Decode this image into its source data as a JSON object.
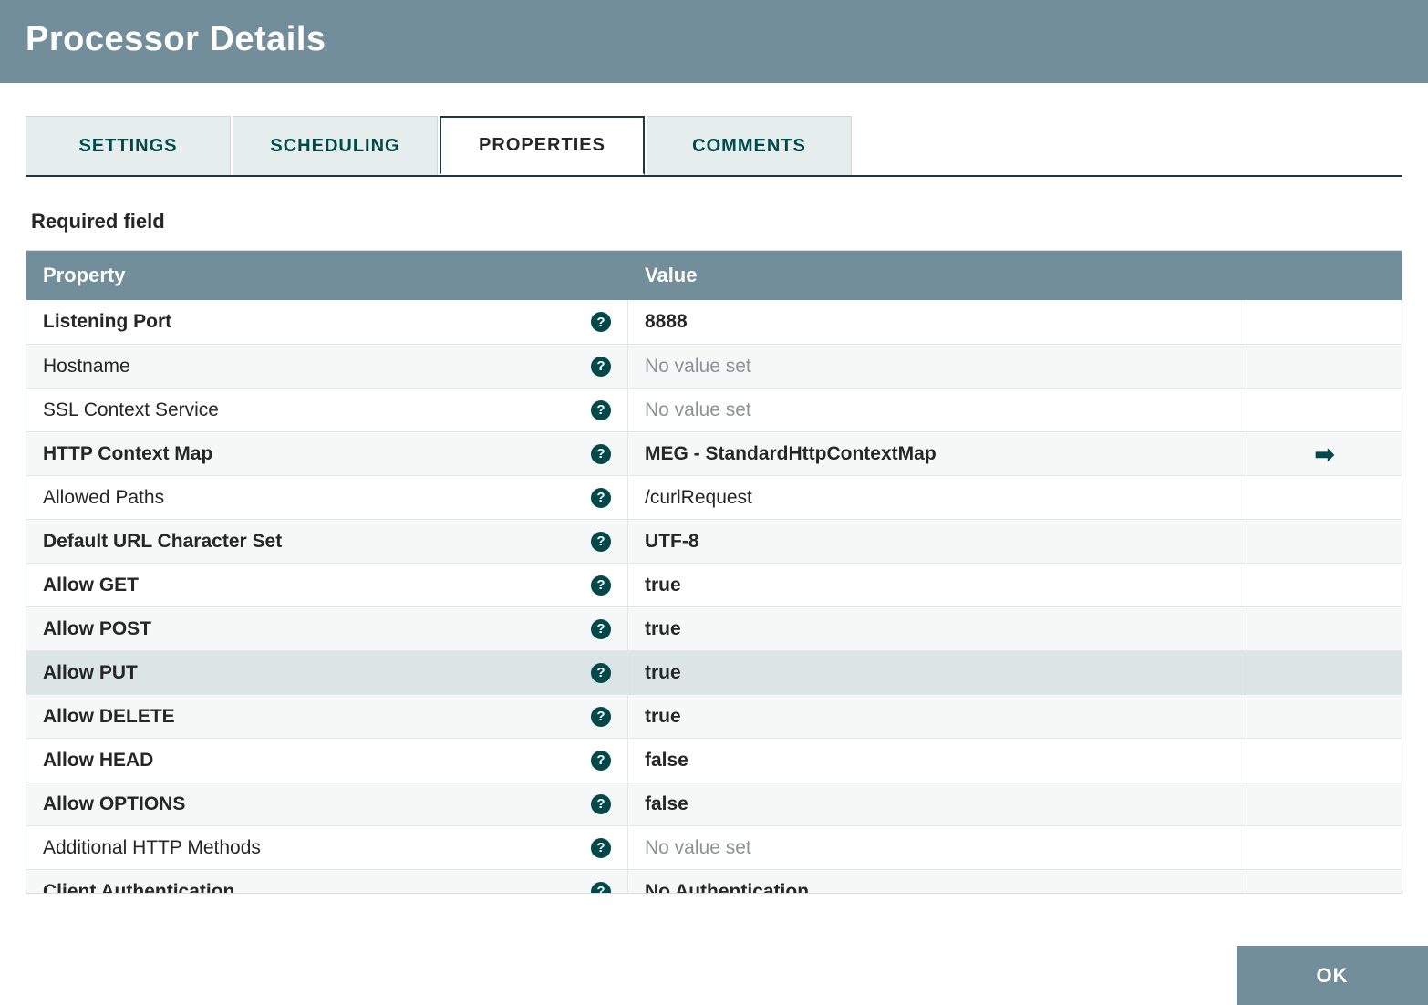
{
  "dialog": {
    "title": "Processor Details",
    "required_label": "Required field"
  },
  "tabs": [
    {
      "label": "SETTINGS",
      "active": false
    },
    {
      "label": "SCHEDULING",
      "active": false
    },
    {
      "label": "PROPERTIES",
      "active": true
    },
    {
      "label": "COMMENTS",
      "active": false
    }
  ],
  "columns": {
    "property": "Property",
    "value": "Value"
  },
  "no_value_text": "No value set",
  "rows": [
    {
      "name": "Listening Port",
      "required": true,
      "value": "8888",
      "link": false,
      "highlight": false
    },
    {
      "name": "Hostname",
      "required": false,
      "value": null,
      "link": false,
      "highlight": false
    },
    {
      "name": "SSL Context Service",
      "required": false,
      "value": null,
      "link": false,
      "highlight": false
    },
    {
      "name": "HTTP Context Map",
      "required": true,
      "value": "MEG - StandardHttpContextMap",
      "link": true,
      "highlight": false
    },
    {
      "name": "Allowed Paths",
      "required": false,
      "value": "/curlRequest",
      "link": false,
      "highlight": false
    },
    {
      "name": "Default URL Character Set",
      "required": true,
      "value": "UTF-8",
      "link": false,
      "highlight": false
    },
    {
      "name": "Allow GET",
      "required": true,
      "value": "true",
      "link": false,
      "highlight": false
    },
    {
      "name": "Allow POST",
      "required": true,
      "value": "true",
      "link": false,
      "highlight": false
    },
    {
      "name": "Allow PUT",
      "required": true,
      "value": "true",
      "link": false,
      "highlight": true
    },
    {
      "name": "Allow DELETE",
      "required": true,
      "value": "true",
      "link": false,
      "highlight": false
    },
    {
      "name": "Allow HEAD",
      "required": true,
      "value": "false",
      "link": false,
      "highlight": false
    },
    {
      "name": "Allow OPTIONS",
      "required": true,
      "value": "false",
      "link": false,
      "highlight": false
    },
    {
      "name": "Additional HTTP Methods",
      "required": false,
      "value": null,
      "link": false,
      "highlight": false
    },
    {
      "name": "Client Authentication",
      "required": true,
      "value": "No Authentication",
      "link": false,
      "highlight": false
    }
  ],
  "footer": {
    "ok": "OK"
  }
}
